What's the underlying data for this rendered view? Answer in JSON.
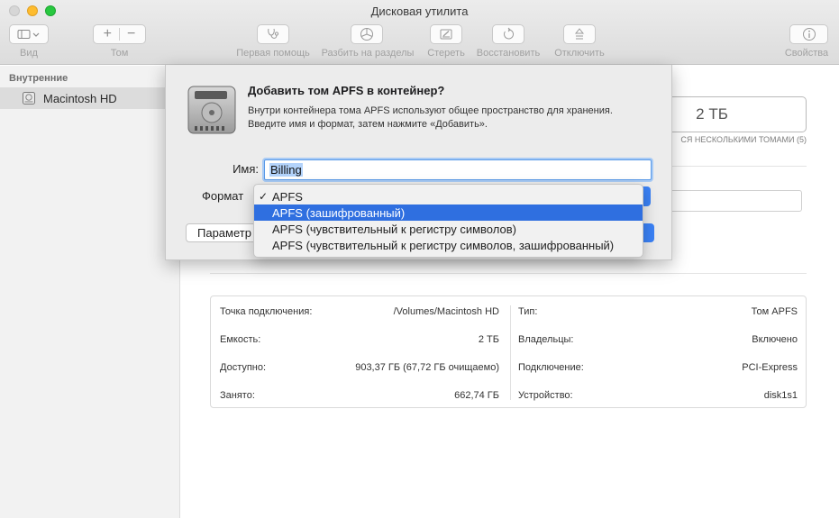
{
  "window": {
    "title": "Дисковая утилита"
  },
  "toolbar": {
    "view_label": "Вид",
    "volume_label": "Том",
    "first_aid_label": "Первая помощь",
    "partition_label": "Разбить на разделы",
    "erase_label": "Стереть",
    "restore_label": "Восстановить",
    "unmount_label": "Отключить",
    "info_label": "Свойства"
  },
  "sidebar": {
    "section": "Внутренние",
    "items": [
      {
        "label": "Macintosh HD"
      }
    ]
  },
  "volume_header": {
    "capacity": "2 ТБ",
    "caption": "СЯ НЕСКОЛЬКИМИ ТОМАМИ (5)"
  },
  "info": {
    "left": [
      {
        "label": "Точка подключения:",
        "value": "/Volumes/Macintosh HD"
      },
      {
        "label": "Емкость:",
        "value": "2 ТБ"
      },
      {
        "label": "Доступно:",
        "value": "903,37 ГБ (67,72 ГБ очищаемо)"
      },
      {
        "label": "Занято:",
        "value": "662,74 ГБ"
      }
    ],
    "right": [
      {
        "label": "Тип:",
        "value": "Том APFS"
      },
      {
        "label": "Владельцы:",
        "value": "Включено"
      },
      {
        "label": "Подключение:",
        "value": "PCI-Express"
      },
      {
        "label": "Устройство:",
        "value": "disk1s1"
      }
    ]
  },
  "sheet": {
    "title": "Добавить том APFS в контейнер?",
    "description": "Внутри контейнера тома APFS используют общее пространство для хранения. Введите имя и формат, затем нажмите «Добавить».",
    "name_label": "Имя:",
    "name_value": "Billing",
    "format_label": "Формат",
    "params_button": "Параметр"
  },
  "format_menu": {
    "selected_index": 0,
    "highlighted_index": 1,
    "options": [
      "APFS",
      "APFS (зашифрованный)",
      "APFS (чувствительный к регистру символов)",
      "APFS (чувствительный к регистру символов, зашифрованный)"
    ]
  },
  "colors": {
    "accent": "#3b82f6",
    "highlight": "#2f6fe0"
  }
}
